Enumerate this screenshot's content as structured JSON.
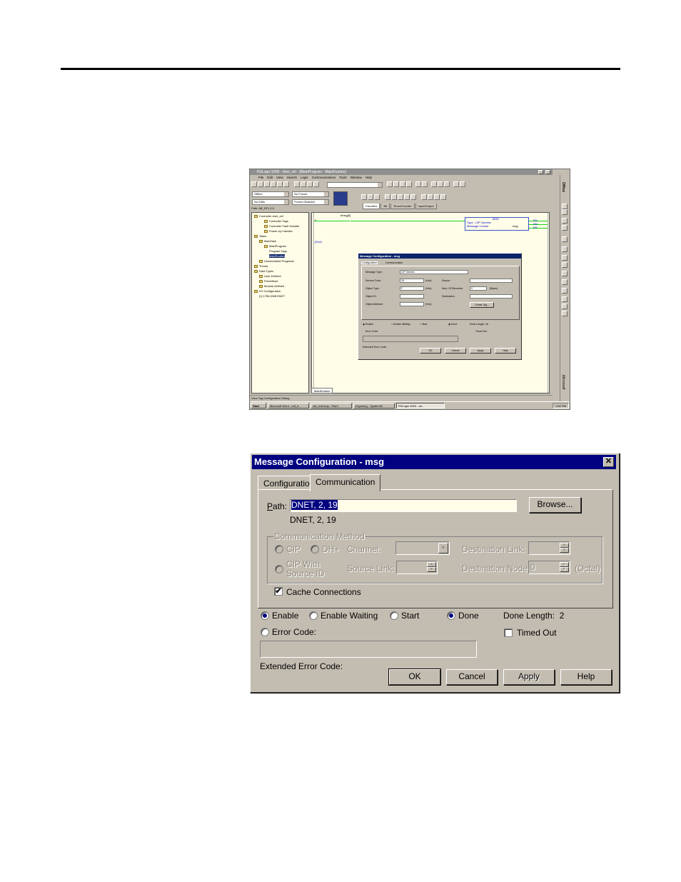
{
  "screenshot": {
    "title": "RSLogix 5000 - dnet_ctrl - [MainProgram - MainRoutine]",
    "menu": [
      "File",
      "Edit",
      "View",
      "Search",
      "Logic",
      "Communications",
      "Tools",
      "Window",
      "Help"
    ],
    "mode_combo": "Offline",
    "forces_combo": "No Forces",
    "edits_combo": "No Edits",
    "forces_status": "Forces Disabled",
    "path": "Path: AB_DF1-1\\1",
    "instruction_tabs": [
      "Favorites",
      "Bit",
      "Timer/Counter",
      "Input/Output"
    ],
    "tree": [
      {
        "label": "Controller dnet_ctrl",
        "indent": 0,
        "folder": true
      },
      {
        "label": "Controller Tags",
        "indent": 2,
        "folder": true
      },
      {
        "label": "Controller Fault Handler",
        "indent": 2,
        "folder": true
      },
      {
        "label": "Power-Up Handler",
        "indent": 2,
        "folder": true
      },
      {
        "label": "Tasks",
        "indent": 0,
        "folder": true
      },
      {
        "label": "MainTask",
        "indent": 1,
        "folder": true
      },
      {
        "label": "MainProgram",
        "indent": 2,
        "folder": true
      },
      {
        "label": "Program Tags",
        "indent": 3,
        "folder": false
      },
      {
        "label": "MainRoutine",
        "indent": 3,
        "folder": false,
        "selected": true
      },
      {
        "label": "Unscheduled Programs",
        "indent": 1,
        "folder": true
      },
      {
        "label": "Trends",
        "indent": 0,
        "folder": true
      },
      {
        "label": "Data Types",
        "indent": 0,
        "folder": true
      },
      {
        "label": "User-Defined",
        "indent": 1,
        "folder": true
      },
      {
        "label": "Predefined",
        "indent": 1,
        "folder": true
      },
      {
        "label": "Module-Defined",
        "indent": 1,
        "folder": true
      },
      {
        "label": "I/O Configuration",
        "indent": 0,
        "folder": true
      },
      {
        "label": "[1] 1756-DNB DNET",
        "indent": 1,
        "folder": false
      }
    ],
    "ladder": {
      "rung_number": "0",
      "end_label": "(End)",
      "contact_tag": "bmsg[0]",
      "msg_title": "MSG",
      "msg_type": "Type - CIP Generic",
      "msg_control": "Message Control",
      "msg_tag": "msg",
      "outputs": [
        "EN",
        "DN",
        "ER"
      ]
    },
    "mini_dialog": {
      "title": "Message Configuration - msg",
      "tabs": [
        "Configuration",
        "Communication"
      ],
      "message_type_label": "Message Type:",
      "message_type_value": "CIP Generic",
      "service_code_label": "Service Code:",
      "service_code_value": "16",
      "object_type_label": "Object Type:",
      "object_type_value": "F",
      "object_id_label": "Object ID:",
      "object_attribute_label": "Object Attribute:",
      "unit_hex": "(Hex)",
      "source_label": "Source:",
      "num_elements_label": "Num. Of Elements:",
      "num_elements_value": "0",
      "bytes_unit": "(Bytes)",
      "destination_label": "Destination:",
      "create_tag_label": "Create Tag...",
      "status": [
        "Enable",
        "Enable Waiting",
        "Start",
        "Done"
      ],
      "done_length": "Done Length: 16",
      "error_code": "Error Code:",
      "timed_out": "Timed Out",
      "extended_error": "Extended Error Code:",
      "buttons": [
        "OK",
        "Cancel",
        "Apply",
        "Help"
      ]
    },
    "bottom_tab": "MainRoutine",
    "status_bar": "View Tag Configuration Dialog",
    "office_label": "Office",
    "microsoft_label": "Microsoft",
    "taskbar": [
      "Start",
      "Microsoft Word - cdf_d...",
      "cdf_chb.bmp - Paint",
      "Exploring - System32",
      "RSLogix 5000 - dn..."
    ],
    "clock": "1:52 PM"
  },
  "dialog": {
    "title": "Message Configuration - msg",
    "close_glyph": "✕",
    "tabs": {
      "configuration": "Configuration",
      "communication": "Communication"
    },
    "path_label": "Path:",
    "path_value": "DNET, 2, 19",
    "path_resolved": "DNET, 2, 19",
    "browse_label": "Browse...",
    "comm_method": {
      "group_label": "Communication Method",
      "cip": "CIP",
      "dh_plus": "DH+",
      "channel_label": "Channel:",
      "destination_link_label": "Destination Link:",
      "cip_with_source_id_line1": "CIP With",
      "cip_with_source_id_line2": "Source ID",
      "source_link_label": "Source Link:",
      "destination_node_label": "Destination Node:",
      "destination_node_value": "0",
      "octal_label": "(Octal)"
    },
    "cache_connections": {
      "label": "Cache Connections",
      "checked": true
    },
    "status": {
      "enable": "Enable",
      "enable_waiting": "Enable Waiting",
      "start": "Start",
      "done": "Done",
      "done_length": "Done Length:  2",
      "error_code": "Error Code:",
      "timed_out": "Timed Out",
      "extended_error_code": "Extended Error Code:"
    },
    "buttons": {
      "ok": "OK",
      "cancel": "Cancel",
      "apply": "Apply",
      "help": "Help"
    }
  }
}
